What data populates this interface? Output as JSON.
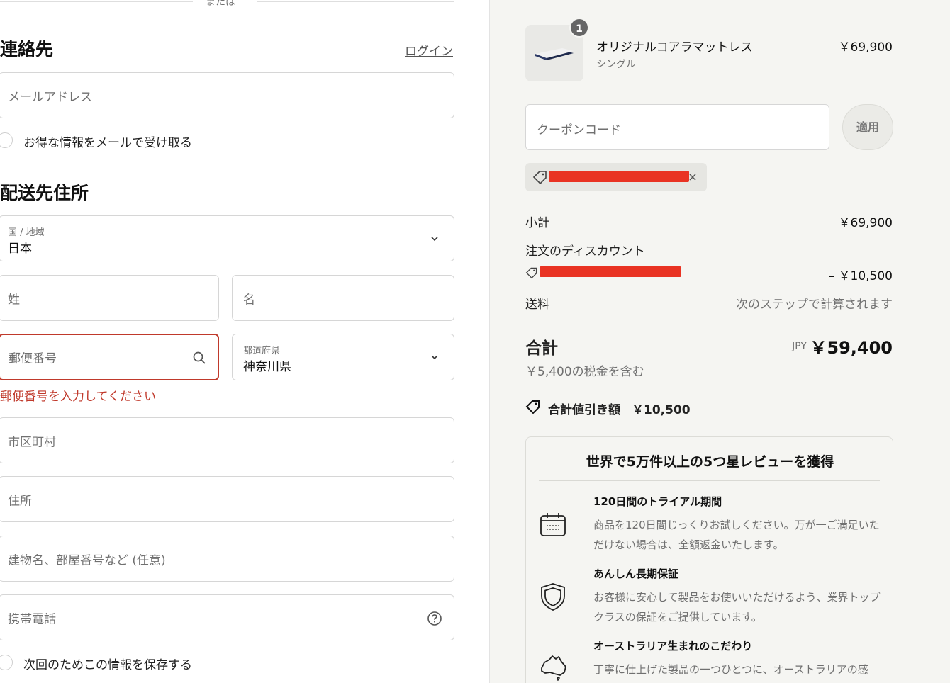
{
  "divider": {
    "text": "または"
  },
  "contact": {
    "heading": "連絡先",
    "login_link": "ログイン",
    "email_placeholder": "メールアドレス",
    "newsletter_label": "お得な情報をメールで受け取る"
  },
  "shipping": {
    "heading": "配送先住所",
    "country_label": "国 / 地域",
    "country_value": "日本",
    "last_name_placeholder": "姓",
    "first_name_placeholder": "名",
    "postal_placeholder": "郵便番号",
    "postal_error": "郵便番号を入力してください",
    "prefecture_label": "都道府県",
    "prefecture_value": "神奈川県",
    "city_placeholder": "市区町村",
    "address_placeholder": "住所",
    "building_placeholder": "建物名、部屋番号など (任意)",
    "phone_placeholder": "携帯電話",
    "save_info_label": "次回のためこの情報を保存する"
  },
  "order": {
    "item": {
      "quantity": "1",
      "name": "オリジナルコアラマットレス",
      "variant": "シングル",
      "price": "￥69,900"
    },
    "coupon_placeholder": "クーポンコード",
    "apply_label": "適用",
    "subtotal_label": "小計",
    "subtotal_value": "￥69,900",
    "discount_label": "注文のディスカウント",
    "discount_value": "– ￥10,500",
    "shipping_label": "送料",
    "shipping_value": "次のステップで計算されます",
    "total_label": "合計",
    "total_currency": "JPY",
    "total_value": "￥59,400",
    "tax_note": "￥5,400の税金を含む",
    "savings_label": "合計値引き額",
    "savings_value": "￥10,500"
  },
  "reviews": {
    "title": "世界で5万件以上の5つ星レビューを獲得",
    "features": [
      {
        "icon": "calendar-icon",
        "title": "120日間のトライアル期間",
        "desc": "商品を120日間じっくりお試しください。万が一ご満足いただけない場合は、全額返金いたします。"
      },
      {
        "icon": "shield-icon",
        "title": "あんしん長期保証",
        "desc": "お客様に安心して製品をお使いいただけるよう、業界トップクラスの保証をご提供しています。"
      },
      {
        "icon": "australia-icon",
        "title": "オーストラリア生まれのこだわり",
        "desc": "丁寧に仕上げた製品の一つひとつに、オーストラリアの感"
      }
    ]
  },
  "colors": {
    "error": "#c0392b",
    "redaction": "#e93323",
    "panel_bg": "#f5f5f2"
  }
}
